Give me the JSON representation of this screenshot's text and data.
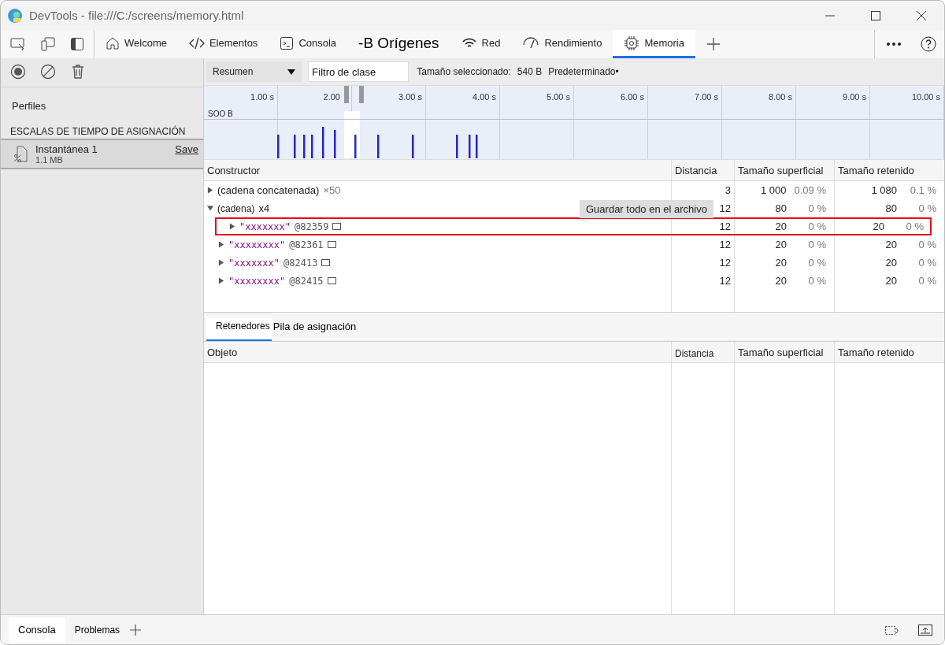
{
  "window": {
    "title": "DevTools - file:///C:/screens/memory.html"
  },
  "tabs": [
    {
      "label": "Welcome",
      "kind": "home",
      "selected": false
    },
    {
      "label": "Elementos",
      "kind": "code",
      "selected": false
    },
    {
      "label": "Consola",
      "kind": "console",
      "selected": false
    },
    {
      "label": "-B Orígenes",
      "kind": "plain",
      "selected": false
    },
    {
      "label": "Red",
      "kind": "network",
      "selected": false
    },
    {
      "label": "Rendimiento",
      "kind": "performance",
      "selected": false
    },
    {
      "label": "Memoria",
      "kind": "memory",
      "selected": true
    }
  ],
  "sidebar": {
    "heading": "Perfiles",
    "section": "ESCALAS DE TIEMPO DE ASIGNACIÓN",
    "profiles": [
      {
        "name": "Instantánea 1",
        "size": "1.1 MB",
        "action": "Save",
        "selected": true
      }
    ]
  },
  "toolbar": {
    "view": "Resumen",
    "filter_placeholder": "Filtro de clase",
    "selected_size_label": "Tamaño seleccionado:",
    "selected_size": "540 B",
    "preset": "Predeterminado•"
  },
  "timeline": {
    "ticks": [
      "1.00 s",
      "2.00",
      "3.00 s",
      "4.00 s",
      "5.00 s",
      "6.00 s",
      "7.00 s",
      "8.00 s",
      "9.00 s",
      "10.00 s"
    ],
    "axis_label": "SOO B"
  },
  "table": {
    "columns": [
      "Constructor",
      "Distancia",
      "Tamaño superficial",
      "Tamaño retenido"
    ],
    "rows": [
      {
        "name": "(cadena concatenada)",
        "kind": "group",
        "count": "×50",
        "expanded": false,
        "highlighted": false,
        "distance": "3",
        "shallow_size": "1 000",
        "shallow_pct": "0.09 %",
        "retained_size": "1 080",
        "retained_pct": "0.1 %",
        "children": []
      },
      {
        "name": "(cadena)",
        "kind": "group",
        "count": "x4",
        "expanded": true,
        "highlighted": false,
        "distance": "12",
        "shallow_size": "80",
        "shallow_pct": "0 %",
        "retained_size": "80",
        "retained_pct": "0 %",
        "children": [
          {
            "name": "\"xxxxxxx\"",
            "kind": "string",
            "count": "@82359",
            "expanded": false,
            "highlighted": true,
            "distance": "12",
            "shallow_size": "20",
            "shallow_pct": "0 %",
            "retained_size": "20",
            "retained_pct": "0 %"
          },
          {
            "name": "\"xxxxxxxx\"",
            "kind": "string",
            "count": "@82361",
            "expanded": false,
            "highlighted": false,
            "distance": "12",
            "shallow_size": "20",
            "shallow_pct": "0 %",
            "retained_size": "20",
            "retained_pct": "0 %"
          },
          {
            "name": "\"xxxxxxx\"",
            "kind": "string",
            "count": "@82413",
            "expanded": false,
            "highlighted": false,
            "distance": "12",
            "shallow_size": "20",
            "shallow_pct": "0 %",
            "retained_size": "20",
            "retained_pct": "0 %"
          },
          {
            "name": "\"xxxxxxxx\"",
            "kind": "string",
            "count": "@82415",
            "expanded": false,
            "highlighted": false,
            "distance": "12",
            "shallow_size": "20",
            "shallow_pct": "0 %",
            "retained_size": "20",
            "retained_pct": "0 %"
          }
        ]
      }
    ]
  },
  "tooltip": "Guardar todo en el archivo",
  "lower_tabs": [
    {
      "label": "Retenedores",
      "selected": true
    },
    {
      "label": "Pila de asignación",
      "selected": false
    }
  ],
  "lower_table": {
    "columns": [
      "Objeto",
      "Distancia",
      "Tamaño superficial",
      "Tamaño retenido"
    ]
  },
  "drawer_tabs": [
    {
      "label": "Consola",
      "selected": true
    },
    {
      "label": "Problemas",
      "selected": false
    }
  ]
}
